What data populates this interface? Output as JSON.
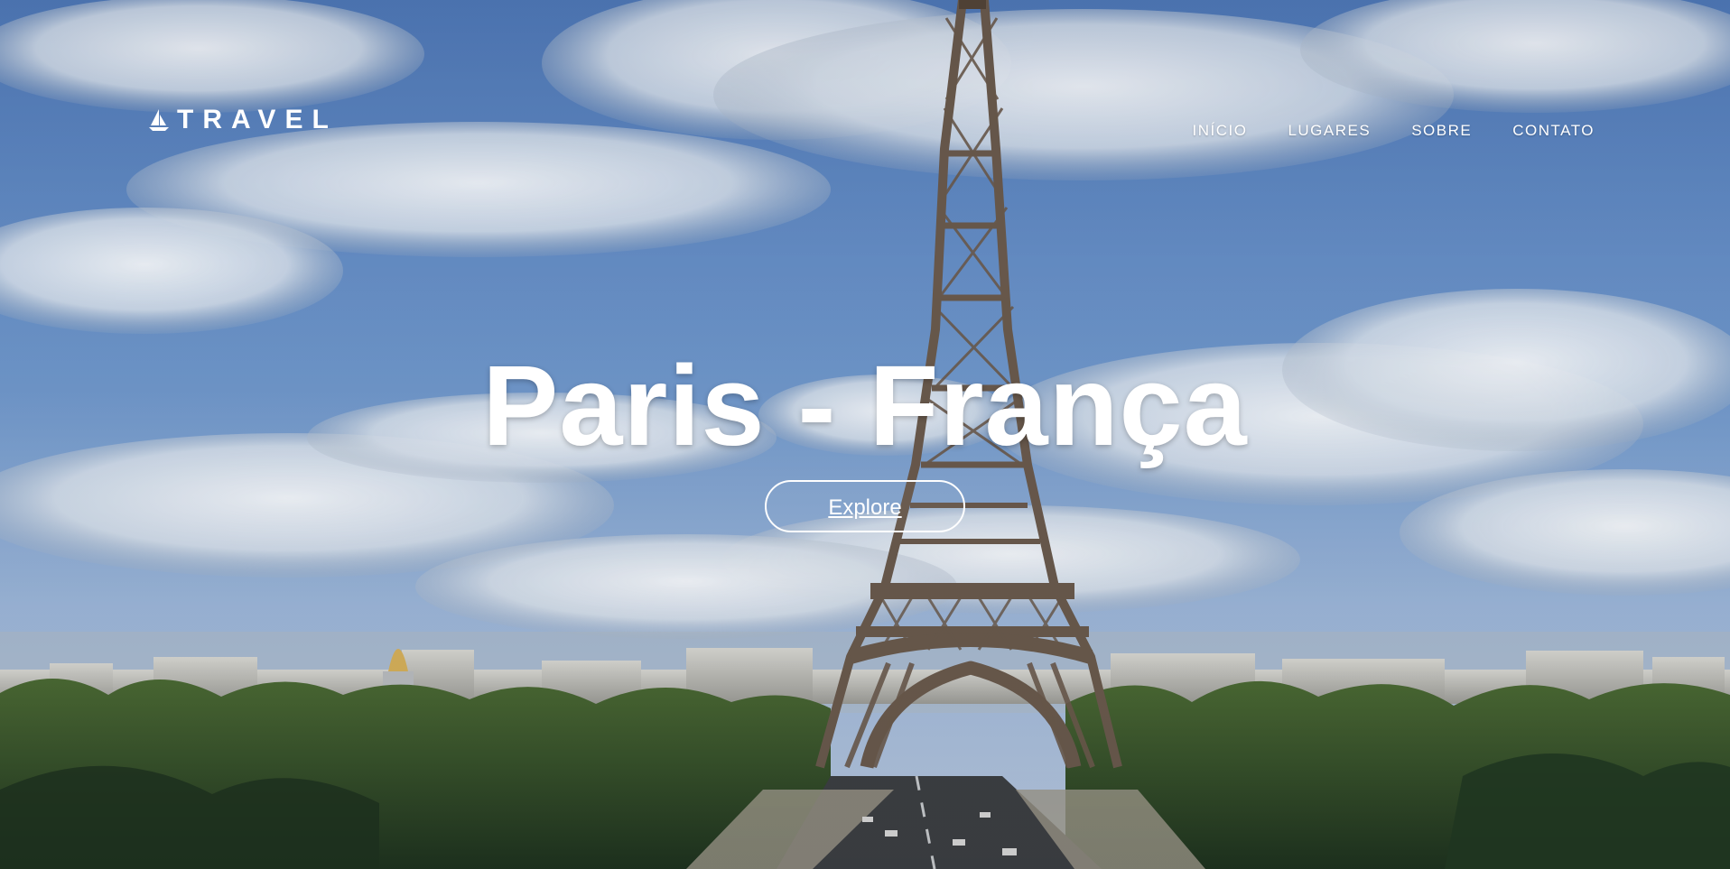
{
  "header": {
    "logo": {
      "text": "TRAVEL",
      "icon": "sailboat-icon"
    },
    "nav": [
      {
        "label": "INÍCIO"
      },
      {
        "label": "LUGARES"
      },
      {
        "label": "SOBRE"
      },
      {
        "label": "CONTATO"
      }
    ]
  },
  "hero": {
    "title": "Paris - França",
    "button": "Explore"
  },
  "colors": {
    "text": "#ffffff",
    "sky": "#5f86c2",
    "tower": "#6a5a4d",
    "trees": "#2f4b2b"
  }
}
